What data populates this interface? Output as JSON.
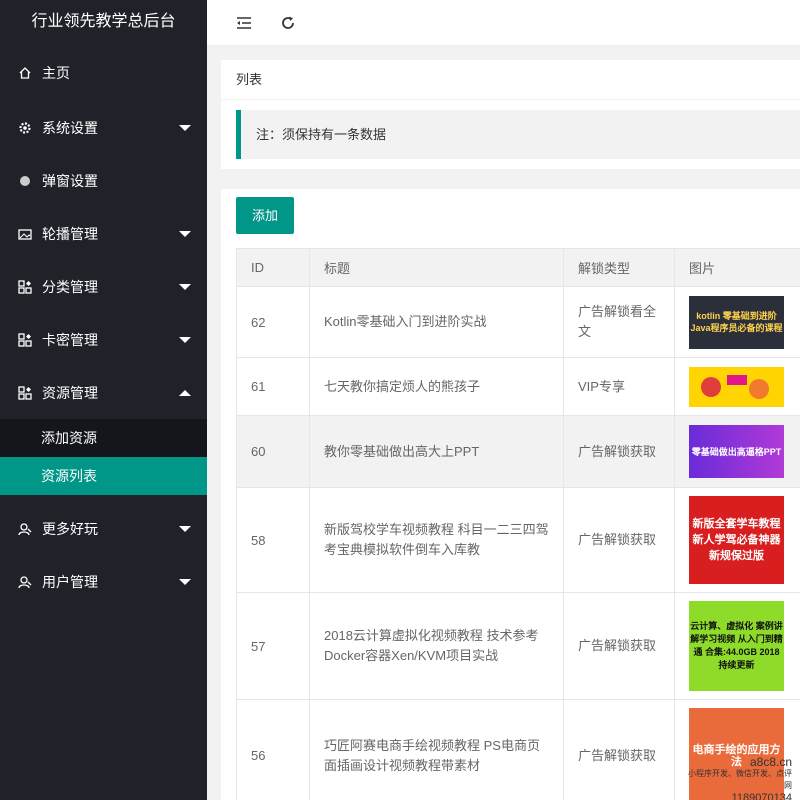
{
  "app": {
    "title": "行业领先教学总后台"
  },
  "sidebar": {
    "items": [
      {
        "label": "主页",
        "icon": "home-icon"
      },
      {
        "label": "系统设置",
        "icon": "gear-icon"
      },
      {
        "label": "弹窗设置",
        "icon": "circle-icon"
      },
      {
        "label": "轮播管理",
        "icon": "image-icon"
      },
      {
        "label": "分类管理",
        "icon": "grid-icon"
      },
      {
        "label": "卡密管理",
        "icon": "grid-icon"
      },
      {
        "label": "资源管理",
        "icon": "grid-icon"
      },
      {
        "label": "更多好玩",
        "icon": "user-icon"
      },
      {
        "label": "用户管理",
        "icon": "user-icon"
      }
    ],
    "submenu": [
      {
        "label": "添加资源"
      },
      {
        "label": "资源列表"
      }
    ]
  },
  "topbar": {
    "collapse_icon": "menu-collapse-icon",
    "refresh_icon": "refresh-icon"
  },
  "main": {
    "header": "列表",
    "note": "注：须保持有一条数据",
    "add_button": "添加",
    "columns": [
      "ID",
      "标题",
      "解锁类型",
      "图片"
    ],
    "rows": [
      {
        "id": "62",
        "title": "Kotlin零基础入门到进阶实战",
        "type": "广告解锁看全文",
        "img": "kotlin 零基础到进阶 Java程序员必备的课程"
      },
      {
        "id": "61",
        "title": "七天教你搞定烦人的熊孩子",
        "type": "VIP专享",
        "img": ""
      },
      {
        "id": "60",
        "title": "教你零基础做出高大上PPT",
        "type": "广告解锁获取",
        "img": "零基础做出高逼格PPT"
      },
      {
        "id": "58",
        "title": "新版驾校学车视频教程 科目一二三四驾考宝典模拟软件倒车入库教",
        "type": "广告解锁获取",
        "img": "新版全套学车教程 新人学驾必备神器 新规保过版"
      },
      {
        "id": "57",
        "title": "2018云计算虚拟化视频教程 技术参考Docker容器Xen/KVM项目实战",
        "type": "广告解锁获取",
        "img": "云计算、虚拟化 案例讲解学习视频 从入门到精通 合集:44.0GB 2018持续更新"
      },
      {
        "id": "56",
        "title": "巧匠阿赛电商手绘视频教程 PS电商页面插画设计视频教程带素材",
        "type": "广告解锁获取",
        "img": "电商手绘的应用方法"
      }
    ]
  },
  "watermark": {
    "line1": "a8c8.cn",
    "line2": "小程序开发、微信开发、点评网",
    "line3": "1189070134"
  },
  "colors": {
    "accent": "#009688",
    "sidebar_bg": "#20222a",
    "submenu_bg": "#15161c"
  }
}
